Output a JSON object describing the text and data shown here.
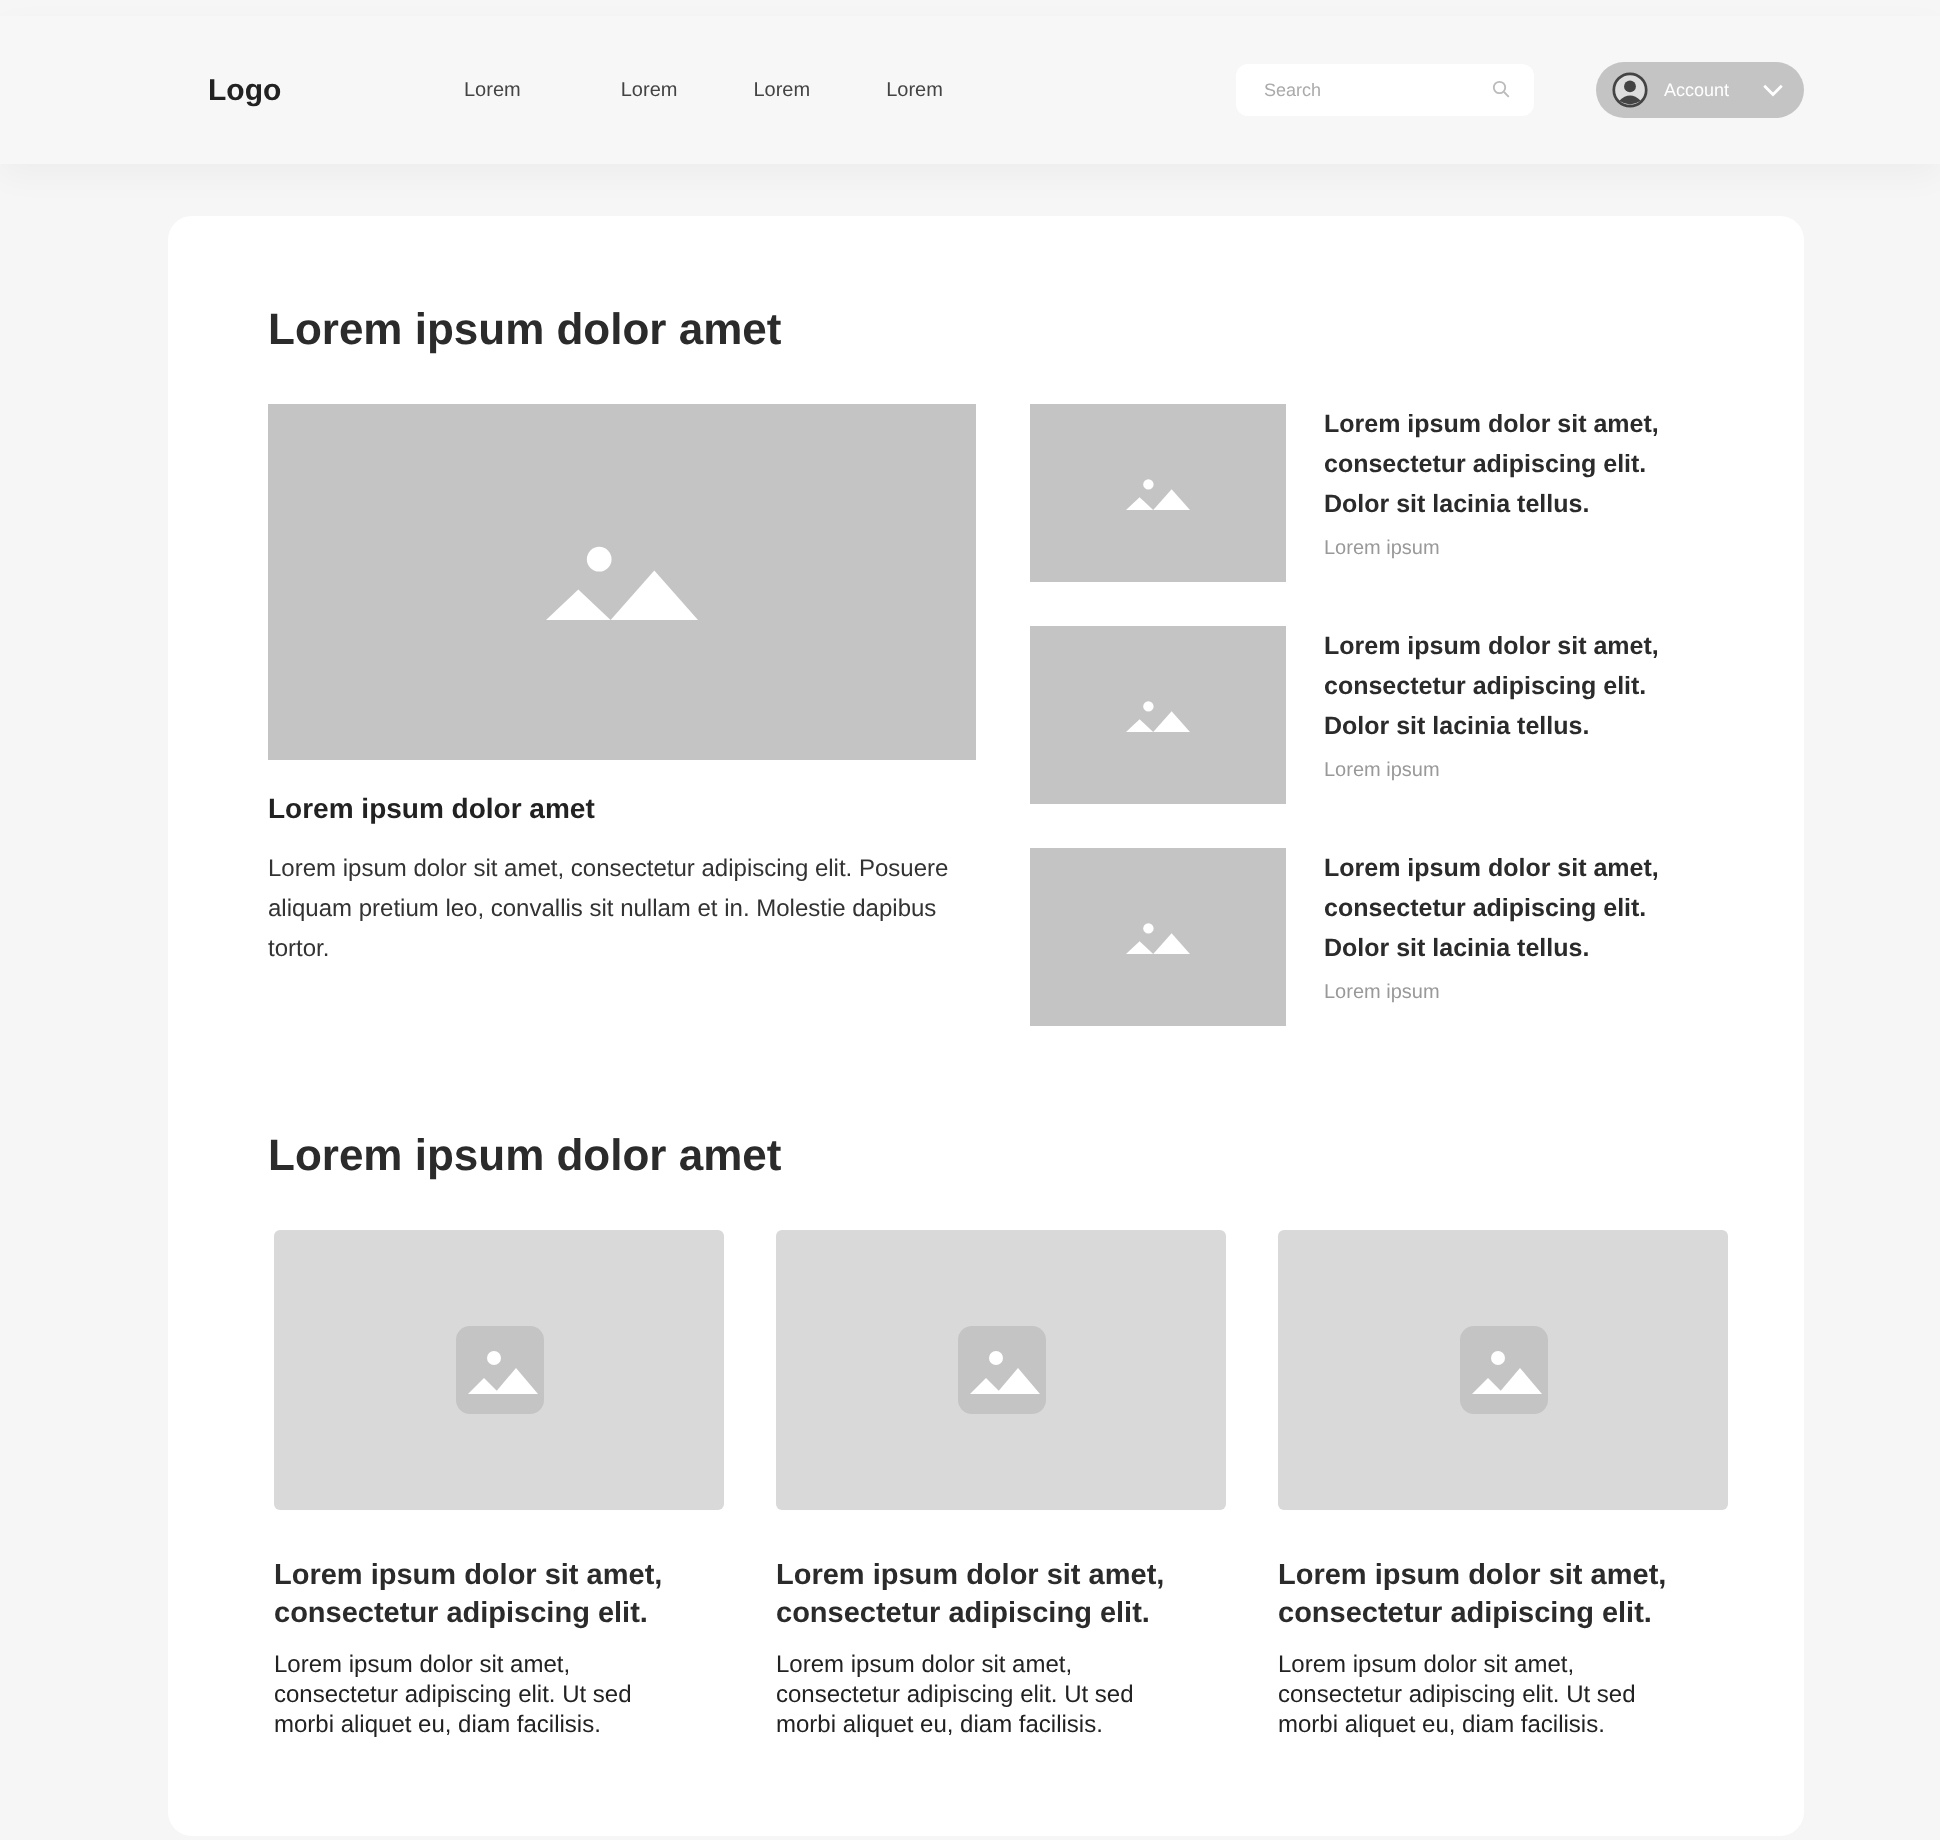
{
  "header": {
    "logo": "Logo",
    "nav": [
      "Lorem",
      "Lorem",
      "Lorem",
      "Lorem"
    ],
    "search": {
      "placeholder": "Search"
    },
    "account": {
      "label": "Account"
    }
  },
  "sections": [
    {
      "title": "Lorem ipsum dolor amet",
      "kind": "featured",
      "featured": {
        "title": "Lorem ipsum dolor amet",
        "text": "Lorem ipsum dolor sit amet, consectetur adipiscing elit. Posuere aliquam pretium leo, convallis sit nullam et in. Molestie dapibus tortor."
      },
      "items": [
        {
          "title": "Lorem ipsum dolor sit amet, consectetur adipiscing elit. Dolor sit lacinia tellus.",
          "meta": "Lorem ipsum"
        },
        {
          "title": "Lorem ipsum dolor sit amet, consectetur adipiscing elit. Dolor sit lacinia tellus.",
          "meta": "Lorem ipsum"
        },
        {
          "title": "Lorem ipsum dolor sit amet, consectetur adipiscing elit. Dolor sit lacinia tellus.",
          "meta": "Lorem ipsum"
        }
      ]
    },
    {
      "title": "Lorem ipsum dolor amet",
      "kind": "cards",
      "items": [
        {
          "title": "Lorem ipsum dolor sit amet, consectetur adipiscing elit.",
          "text": "Lorem ipsum dolor sit amet, consectetur adipiscing elit. Ut sed morbi aliquet eu, diam facilisis."
        },
        {
          "title": "Lorem ipsum dolor sit amet, consectetur adipiscing elit.",
          "text": "Lorem ipsum dolor sit amet, consectetur adipiscing elit. Ut sed morbi aliquet eu, diam facilisis."
        },
        {
          "title": "Lorem ipsum dolor sit amet, consectetur adipiscing elit.",
          "text": "Lorem ipsum dolor sit amet, consectetur adipiscing elit. Ut sed morbi aliquet eu, diam facilisis."
        }
      ]
    }
  ]
}
